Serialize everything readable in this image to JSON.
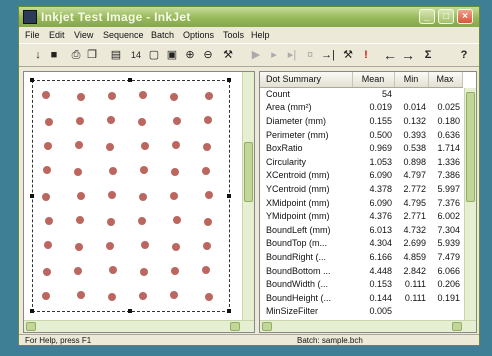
{
  "window": {
    "title": "Inkjet Test Image - InkJet",
    "buttons": {
      "minimize": "_",
      "maximize": "□",
      "close": "×"
    }
  },
  "menu": [
    "File",
    "Edit",
    "View",
    "Sequence",
    "Batch",
    "Options",
    "Tools",
    "Help"
  ],
  "toolbar": {
    "icons": [
      "open-icon",
      "save-icon",
      "print-icon",
      "copy-icon",
      "paste-icon",
      "mark-icon",
      "fit-icon",
      "fit-width-icon",
      "zoom-in-icon",
      "zoom-out-icon",
      "measure-icon",
      "play-icon",
      "forward-icon",
      "forward-end-icon",
      "lock-icon",
      "jump-icon",
      "settings-icon",
      "alert-icon",
      "arrow-left-icon",
      "arrow-right-icon",
      "sigma-icon",
      "help-icon"
    ],
    "glyphs": [
      "↓",
      "■",
      "⎙",
      "❐",
      "▤",
      "14",
      "▢",
      "▣",
      "⊕",
      "⊖",
      "⚒",
      "▶",
      "▸",
      "▸|",
      "¤",
      "→|",
      "⚒",
      "!",
      "←",
      "→",
      "Σ",
      "?"
    ]
  },
  "summary": {
    "headers": [
      "Dot Summary",
      "Mean",
      "Min",
      "Max"
    ],
    "rows": [
      [
        "Count",
        "54",
        "",
        ""
      ],
      [
        "Area (mm²)",
        "0.019",
        "0.014",
        "0.025"
      ],
      [
        "Diameter (mm)",
        "0.155",
        "0.132",
        "0.180"
      ],
      [
        "Perimeter (mm)",
        "0.500",
        "0.393",
        "0.636"
      ],
      [
        "BoxRatio",
        "0.969",
        "0.538",
        "1.714"
      ],
      [
        "Circularity",
        "1.053",
        "0.898",
        "1.336"
      ],
      [
        "XCentroid (mm)",
        "6.090",
        "4.797",
        "7.386"
      ],
      [
        "YCentroid (mm)",
        "4.378",
        "2.772",
        "5.997"
      ],
      [
        "XMidpoint (mm)",
        "6.090",
        "4.795",
        "7.376"
      ],
      [
        "YMidpoint (mm)",
        "4.376",
        "2.771",
        "6.002"
      ],
      [
        "BoundLeft (mm)",
        "6.013",
        "4.732",
        "7.304"
      ],
      [
        "BoundTop (m...",
        "4.304",
        "2.699",
        "5.939"
      ],
      [
        "BoundRight (...",
        "6.166",
        "4.859",
        "7.479"
      ],
      [
        "BoundBottom ...",
        "4.448",
        "2.842",
        "6.066"
      ],
      [
        "BoundWidth (...",
        "0.153",
        "0.111",
        "0.206"
      ],
      [
        "BoundHeight (...",
        "0.144",
        "0.111",
        "0.191"
      ],
      [
        "MinSizeFilter",
        "0.005",
        "",
        ""
      ]
    ]
  },
  "status": {
    "help": "For Help, press F1",
    "batch": "Batch: sample.bch"
  },
  "colors": {
    "spot": "#b5554f",
    "title_bar": "#97b85a",
    "background": "#3f7f96"
  }
}
